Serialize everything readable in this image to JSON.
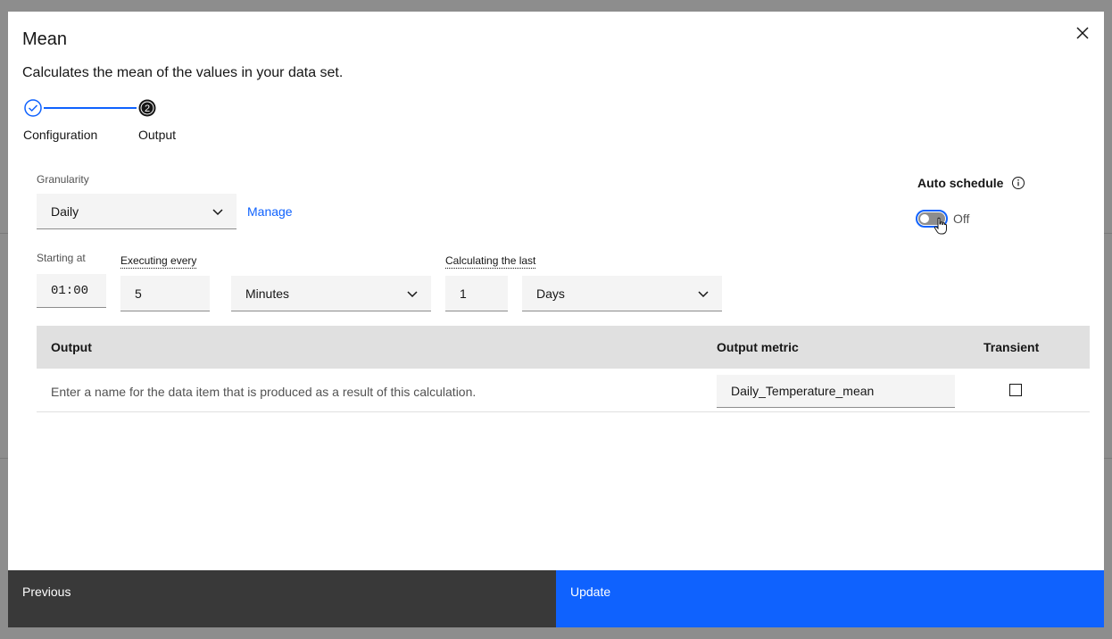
{
  "modal": {
    "title": "Mean",
    "description": "Calculates the mean of the values in your data set."
  },
  "steps": [
    {
      "label": "Configuration",
      "state": "complete"
    },
    {
      "label": "Output",
      "state": "current",
      "number": "2"
    }
  ],
  "granularity": {
    "label": "Granularity",
    "value": "Daily",
    "manage_link": "Manage"
  },
  "auto_schedule": {
    "label": "Auto schedule",
    "state": "Off"
  },
  "schedule": {
    "starting_at_label": "Starting at",
    "starting_at_value": "01:00",
    "executing_every_label": "Executing every",
    "executing_every_value": "5",
    "executing_every_unit": "Minutes",
    "calculating_last_label": "Calculating the last",
    "calculating_last_value": "1",
    "calculating_last_unit": "Days"
  },
  "table": {
    "headers": [
      "Output",
      "Output metric",
      "Transient"
    ],
    "rows": [
      {
        "description": "Enter a name for the data item that is produced as a result of this calculation.",
        "metric": "Daily_Temperature_mean",
        "transient": false
      }
    ]
  },
  "footer": {
    "previous_label": "Previous",
    "update_label": "Update"
  },
  "colors": {
    "primary": "#0f62fe",
    "secondary_button": "#393939",
    "field_bg": "#f4f4f4"
  }
}
